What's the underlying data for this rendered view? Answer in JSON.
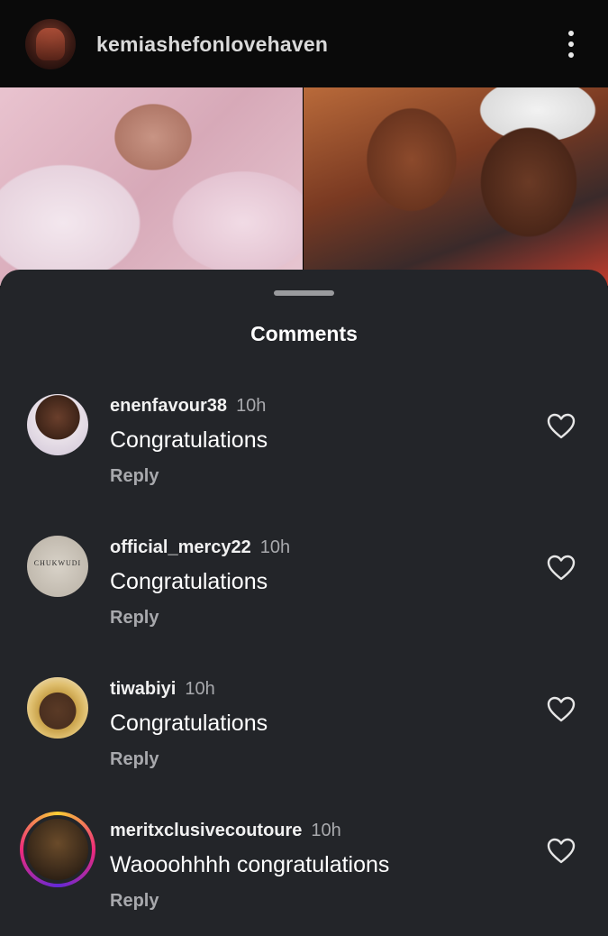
{
  "header": {
    "username": "kemiashefonlovehaven",
    "avatar_icon": "profile-avatar"
  },
  "sheet": {
    "title": "Comments"
  },
  "comments": [
    {
      "user": "enenfavour38",
      "time": "10h",
      "text": "Congratulations",
      "reply": "Reply"
    },
    {
      "user": "official_mercy22",
      "time": "10h",
      "text": "Congratulations",
      "reply": "Reply",
      "avatar_text": "CHUKWUDI"
    },
    {
      "user": "tiwabiyi",
      "time": "10h",
      "text": "Congratulations",
      "reply": "Reply"
    },
    {
      "user": "meritxclusivecoutoure",
      "time": "10h",
      "text": "Waooohhhh congratulations",
      "reply": "Reply"
    }
  ],
  "colors": {
    "sheet_bg": "#232529",
    "muted_text": "#a8a9ad",
    "story_ring": [
      "#f9ce34",
      "#ee2a7b",
      "#6228d7"
    ]
  }
}
